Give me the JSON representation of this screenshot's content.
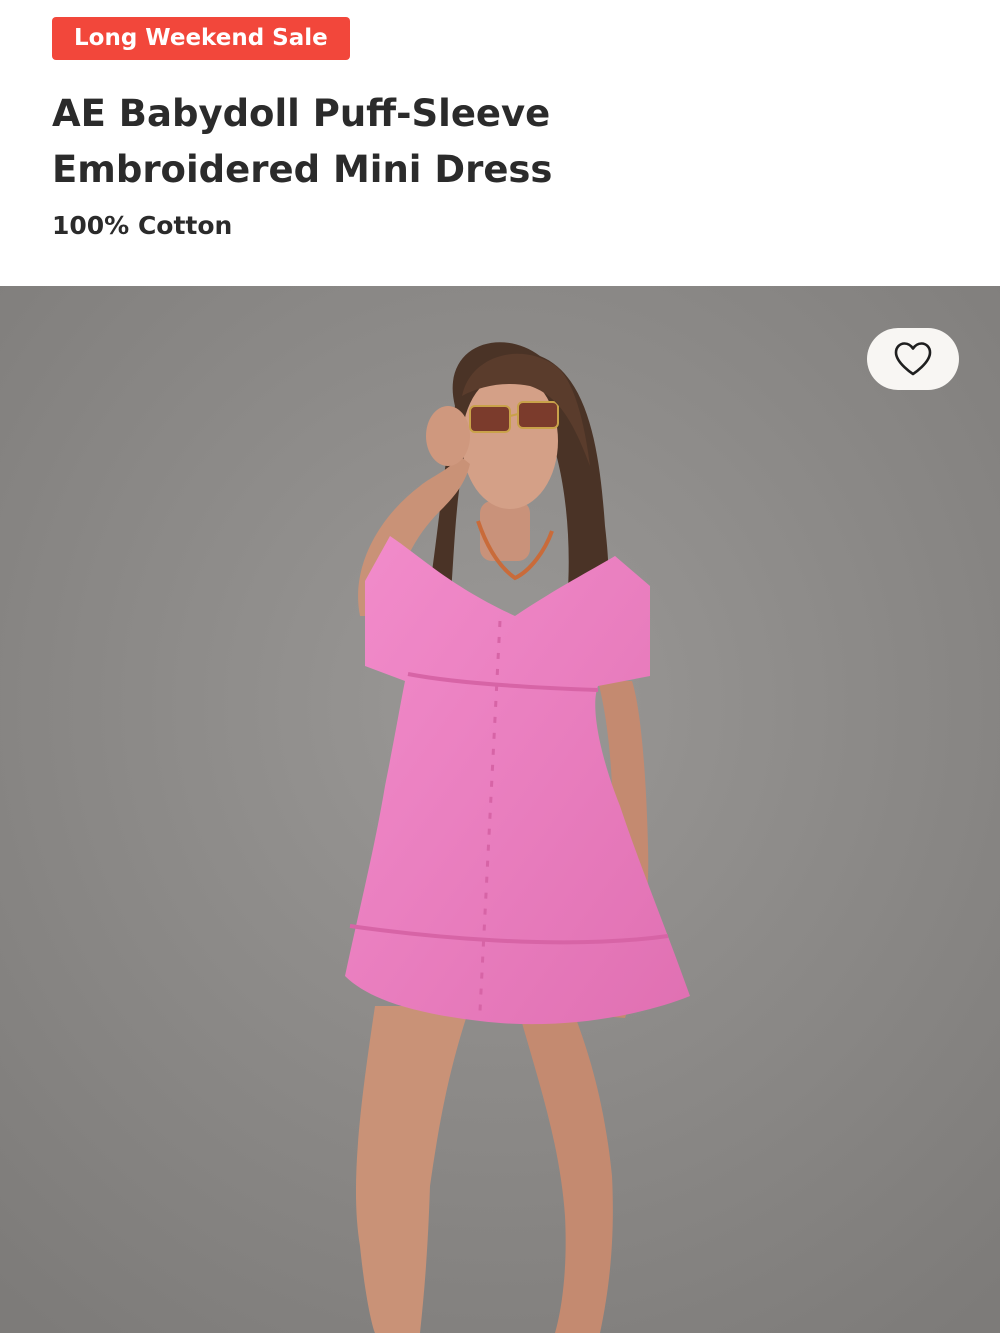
{
  "product": {
    "badge": "Long Weekend Sale",
    "title_lines": [
      "AE Babydoll Puff-Sleeve",
      "Embroidered Mini Dress"
    ],
    "material": "100% Cotton"
  },
  "image": {
    "subject": "model-wearing-pink-babydoll-mini-dress",
    "background_color": "#8a8886",
    "dress_color": "#ee7fc0"
  },
  "wishlist": {
    "icon": "heart-outline-icon",
    "state": "not-saved"
  },
  "colors": {
    "badge_bg": "#f2473b",
    "badge_text": "#ffffff",
    "title_text": "#2b2b2b"
  }
}
